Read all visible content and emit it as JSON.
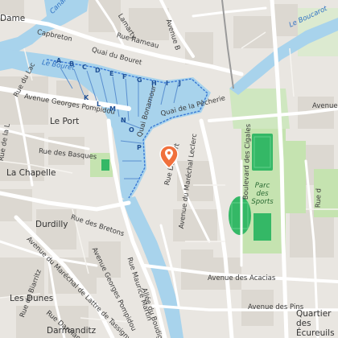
{
  "map": {
    "streets": {
      "dame": "Dame",
      "canal_top": "Canal",
      "le_bouret_canal": "Le Boucarot",
      "capbreton": "Capbreton",
      "lamarty": "Lamarty",
      "avenue_b": "Avenue B",
      "quai_bouret": "Quai du Bouret",
      "rue_rameau": "Rue Rameau",
      "le_bouret_water": "Le Bouret",
      "avenue_top_right": "Avenue",
      "quai_pecherie": "Quai de la Pêcherie",
      "rue_du_lac": "Rue du Lac",
      "av_georges_pompidou": "Avenue Georges Pompidou",
      "le_port": "Le Port",
      "rue_de_la_lande": "Rue de la L",
      "rue_des_basques": "Rue des Basques",
      "quai_bonamour": "Quai Bonamour",
      "la_chapelle": "La Chapelle",
      "rue_doubert": "Rue Doubert",
      "avenue_mal_leclerc": "Avenue du Maréchal Leclerc",
      "boulevard_cigales": "Boulevard des Cigales",
      "durdilly": "Durdilly",
      "rue_des_bretons": "Rue des Bretons",
      "av_mal_lattre": "Avenue du Maréchal de Lattre de Tassigny",
      "av_georges_pompidou_2": "Avenue Georges Pompidou",
      "rue_maurice_martin": "Rue Maurice Martin",
      "allee_du_boudigau": "Allée du Boudigau",
      "avenue_acacias": "Avenue des Acacias",
      "avenue_des_pins": "Avenue des Pins",
      "les_dunes": "Les Dunes",
      "rue_darmanditz": "Rue Darmanditz",
      "rue_de_biarritz": "Rue de Biarritz",
      "darmanditz": "Darmanditz",
      "quartier_ecureuils": "Quartier des Écureuils",
      "rue_right": "Rue d"
    },
    "parc_des_sports": "Parc des Sports",
    "harbour_pontoon_letters": [
      "A",
      "B",
      "C",
      "D",
      "E",
      "F",
      "G",
      "H",
      "I",
      "J",
      "K",
      "L",
      "M",
      "N",
      "O",
      "P"
    ],
    "colors": {
      "land": "#e9e6e1",
      "water": "#a8d3ec",
      "park": "#c5e3b0",
      "sports_field": "#34b866",
      "harbour_boundary": "#3a7ad6",
      "pin": "#f0703c",
      "road": "#ffffff"
    },
    "marker_icon": "location-pin-icon"
  }
}
